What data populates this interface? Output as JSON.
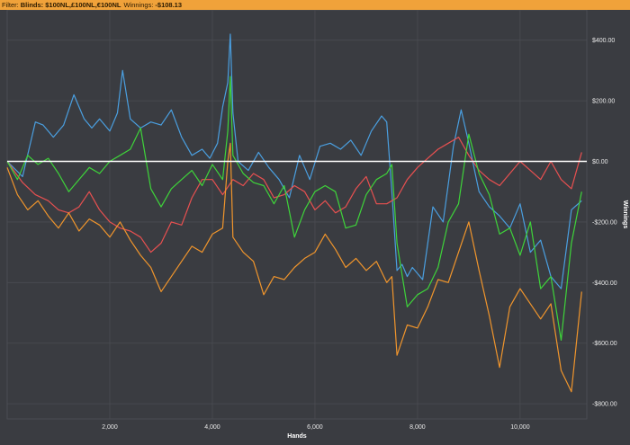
{
  "filter": {
    "label": "Filter:",
    "value": "Blinds: $100NL,£100NL,€100NL",
    "winnings_label": "Winnings:",
    "winnings_value": "-$108.13"
  },
  "colors": {
    "background": "#3a3c41",
    "grid": "#4a4c52",
    "filter_bar": "#f0a23a",
    "zero_line": "#ffffff"
  },
  "chart_data": {
    "type": "line",
    "title": "",
    "xlabel": "Hands",
    "ylabel": "Winnings",
    "xlim": [
      0,
      11300
    ],
    "ylim": [
      -850,
      500
    ],
    "grid": true,
    "y_axis_side": "right",
    "legend": "none",
    "x_ticks": [
      2000,
      4000,
      6000,
      8000,
      10000
    ],
    "x_tick_labels": [
      "2,000",
      "4,000",
      "6,000",
      "8,000",
      "10,000"
    ],
    "y_ticks": [
      400,
      200,
      0,
      -200,
      -400,
      -600,
      -800
    ],
    "y_tick_labels": [
      "$400.00",
      "$200.00",
      "$0.00",
      "-$200.00",
      "-$400.00",
      "-$600.00",
      "-$800.00"
    ],
    "series": [
      {
        "color": "#4a9fe0",
        "x": [
          0,
          300,
          550,
          700,
          900,
          1100,
          1300,
          1500,
          1650,
          1800,
          2000,
          2150,
          2250,
          2400,
          2600,
          2800,
          3000,
          3200,
          3400,
          3600,
          3800,
          3950,
          4100,
          4200,
          4300,
          4350,
          4400,
          4500,
          4700,
          4900,
          5100,
          5300,
          5500,
          5700,
          5900,
          6100,
          6300,
          6500,
          6700,
          6900,
          7100,
          7300,
          7400,
          7500,
          7600,
          7700,
          7800,
          7900,
          8100,
          8300,
          8500,
          8700,
          8850,
          9000,
          9200,
          9400,
          9600,
          9800,
          10000,
          10200,
          10400,
          10600,
          10800,
          11000,
          11200
        ],
        "y": [
          0,
          -50,
          130,
          120,
          80,
          120,
          220,
          140,
          110,
          140,
          100,
          160,
          300,
          140,
          110,
          130,
          120,
          170,
          80,
          20,
          40,
          10,
          60,
          180,
          260,
          420,
          160,
          0,
          -30,
          30,
          -20,
          -60,
          -120,
          20,
          -60,
          50,
          60,
          40,
          70,
          20,
          100,
          150,
          130,
          -100,
          -360,
          -340,
          -380,
          -350,
          -390,
          -150,
          -200,
          50,
          170,
          60,
          -100,
          -150,
          -180,
          -220,
          -140,
          -300,
          -260,
          -380,
          -420,
          -160,
          -130
        ]
      },
      {
        "color": "#e85050",
        "x": [
          0,
          300,
          550,
          800,
          1000,
          1200,
          1400,
          1600,
          1800,
          2000,
          2200,
          2400,
          2600,
          2800,
          3000,
          3200,
          3400,
          3600,
          3800,
          4000,
          4200,
          4400,
          4600,
          4800,
          5000,
          5200,
          5400,
          5600,
          5800,
          6000,
          6200,
          6400,
          6600,
          6800,
          7000,
          7200,
          7400,
          7600,
          7800,
          8000,
          8200,
          8400,
          8600,
          8800,
          9000,
          9200,
          9400,
          9600,
          9800,
          10000,
          10200,
          10400,
          10600,
          10800,
          11000,
          11200
        ],
        "y": [
          0,
          -70,
          -110,
          -130,
          -160,
          -170,
          -150,
          -100,
          -160,
          -200,
          -220,
          -230,
          -250,
          -300,
          -270,
          -200,
          -210,
          -120,
          -60,
          -60,
          -110,
          -60,
          -80,
          -40,
          -60,
          -120,
          -110,
          -80,
          -100,
          -160,
          -130,
          -170,
          -150,
          -90,
          -50,
          -140,
          -140,
          -120,
          -60,
          -20,
          10,
          40,
          60,
          80,
          20,
          -30,
          -60,
          -80,
          -40,
          0,
          -30,
          -60,
          0,
          -60,
          -90,
          30
        ]
      },
      {
        "color": "#3ed43a",
        "x": [
          0,
          200,
          400,
          600,
          800,
          1000,
          1200,
          1400,
          1600,
          1800,
          2000,
          2200,
          2400,
          2600,
          2800,
          3000,
          3200,
          3400,
          3600,
          3800,
          4000,
          4200,
          4300,
          4350,
          4400,
          4600,
          4800,
          5000,
          5200,
          5400,
          5600,
          5800,
          6000,
          6200,
          6400,
          6600,
          6800,
          7000,
          7200,
          7400,
          7500,
          7600,
          7800,
          8000,
          8200,
          8400,
          8600,
          8800,
          9000,
          9200,
          9400,
          9600,
          9800,
          10000,
          10200,
          10400,
          10600,
          10800,
          11000,
          11200
        ],
        "y": [
          0,
          -60,
          20,
          -10,
          10,
          -40,
          -100,
          -60,
          -20,
          -40,
          0,
          20,
          40,
          110,
          -90,
          -150,
          -90,
          -60,
          -30,
          -80,
          -10,
          -60,
          100,
          280,
          20,
          -40,
          -70,
          -80,
          -140,
          -80,
          -250,
          -160,
          -100,
          -80,
          -100,
          -220,
          -210,
          -110,
          -60,
          -40,
          -10,
          -270,
          -480,
          -440,
          -420,
          -350,
          -200,
          -140,
          90,
          -40,
          -110,
          -240,
          -220,
          -310,
          -200,
          -420,
          -380,
          -590,
          -270,
          -100
        ]
      },
      {
        "color": "#f0952c",
        "x": [
          0,
          200,
          400,
          600,
          800,
          1000,
          1200,
          1400,
          1600,
          1800,
          2000,
          2200,
          2400,
          2600,
          2800,
          3000,
          3200,
          3400,
          3600,
          3800,
          4000,
          4200,
          4300,
          4350,
          4400,
          4600,
          4800,
          5000,
          5200,
          5400,
          5600,
          5800,
          6000,
          6200,
          6400,
          6600,
          6800,
          7000,
          7200,
          7400,
          7500,
          7600,
          7800,
          8000,
          8200,
          8400,
          8600,
          8800,
          9000,
          9200,
          9400,
          9600,
          9800,
          10000,
          10200,
          10400,
          10600,
          10800,
          11000,
          11200
        ],
        "y": [
          -20,
          -110,
          -160,
          -130,
          -180,
          -220,
          -170,
          -230,
          -190,
          -210,
          -250,
          -200,
          -260,
          -310,
          -350,
          -430,
          -380,
          -330,
          -280,
          -300,
          -240,
          -220,
          0,
          60,
          -250,
          -300,
          -330,
          -440,
          -380,
          -390,
          -350,
          -320,
          -300,
          -240,
          -290,
          -350,
          -320,
          -360,
          -330,
          -400,
          -380,
          -640,
          -540,
          -550,
          -480,
          -390,
          -400,
          -300,
          -200,
          -360,
          -510,
          -680,
          -480,
          -420,
          -470,
          -520,
          -470,
          -690,
          -760,
          -430
        ]
      },
      {
        "color": "#ffffff",
        "x": [
          0,
          11300
        ],
        "y": [
          0,
          0
        ]
      }
    ]
  }
}
